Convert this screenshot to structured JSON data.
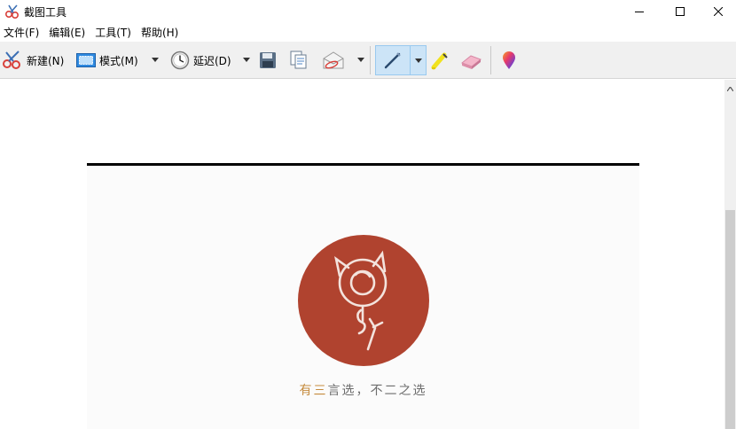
{
  "window": {
    "title": "截图工具",
    "icon": "scissors-app-icon"
  },
  "window_controls": {
    "minimize_icon": "minimize-icon",
    "maximize_icon": "maximize-icon",
    "close_icon": "close-icon"
  },
  "menu": [
    {
      "label": "文件(F)"
    },
    {
      "label": "编辑(E)"
    },
    {
      "label": "工具(T)"
    },
    {
      "label": "帮助(H)"
    }
  ],
  "toolbar": {
    "new_label": "新建(N)",
    "mode_label": "模式(M)",
    "delay_label": "延迟(D)",
    "pen_selected": true
  },
  "canvas": {
    "tagline_accent": "有三",
    "tagline_rest": "言选，不二之选",
    "logo_colors": {
      "circle": "#b0432f",
      "stroke": "#f3e3dd"
    }
  },
  "colors": {
    "toolbar_bg": "#f0f0f0",
    "selected_bg": "#cce4f7",
    "tagline_accent": "#c58b3e"
  }
}
